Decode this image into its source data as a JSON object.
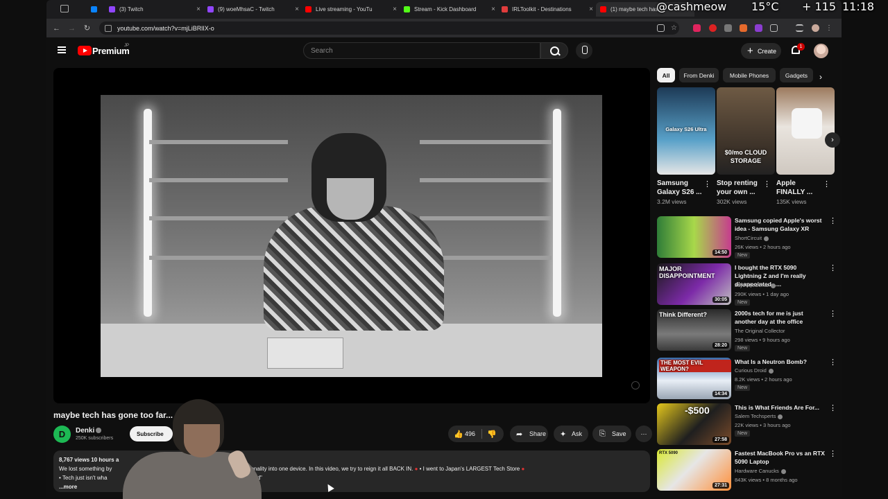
{
  "browser": {
    "tabs": [
      {
        "title": "(3) Twitch",
        "color": "#9146ff"
      },
      {
        "title": "(9) woeMhsaC - Twitch",
        "color": "#9146ff"
      },
      {
        "title": "Live streaming - YouTu",
        "color": "#ff0000"
      },
      {
        "title": "Stream - Kick Dashboard",
        "color": "#53fc18"
      },
      {
        "title": "IRLToolkit - Destinations",
        "color": "#e03c3c"
      },
      {
        "title": "(1) maybe tech has",
        "color": "#ff0000"
      }
    ],
    "url": "youtube.com/watch?v=mjLiBRlIX-o"
  },
  "hud": {
    "handle": "@cashmeow",
    "temp": "15°C",
    "speed": "+ 115",
    "time": "11:18"
  },
  "youtube": {
    "brand": "Premium",
    "region": "JP",
    "search_placeholder": "Search",
    "create_label": "Create",
    "notification_count": "1"
  },
  "video": {
    "title": "maybe tech has gone too far...",
    "channel": {
      "name": "Denki",
      "initial": "D",
      "subscribers": "250K subscribers"
    },
    "subscribe_label": "Subscribe",
    "likes": "496",
    "share_label": "Share",
    "ask_label": "Ask",
    "save_label": "Save",
    "description": {
      "stats": "8,767 views  10 hours a",
      "line1_start": "We lost something by",
      "line1_end": "LOT of functionality into one device. In this video, we try to reign it all BACK IN.",
      "line1_link": "• I went to Japan's LARGEST Tech Store",
      "line2_start": "• Tech just isn't wha",
      "line2_end": "iPod\"",
      "more": "...more"
    }
  },
  "sidebar": {
    "chips": [
      "All",
      "From Denki",
      "Mobile Phones",
      "Gadgets"
    ],
    "shorts": [
      {
        "title": "Samsung Galaxy S26 ...",
        "views": "3.2M views",
        "overlay": "Galaxy S26 Ultra"
      },
      {
        "title": "Stop renting your own ...",
        "views": "302K views",
        "overlay": "$0/mo CLOUD STORAGE"
      },
      {
        "title": "Apple FINALLY ...",
        "views": "135K views",
        "overlay": ""
      }
    ],
    "recommendations": [
      {
        "title": "Samsung copied Apple's worst idea - Samsung Galaxy XR",
        "channel": "ShortCircuit",
        "meta": "26K views • 2 hours ago",
        "badge": "New",
        "duration": "14:50",
        "thumb_text": ""
      },
      {
        "title": "I bought the RTX 5090 Lightning Z and I'm really disappointed......",
        "channel": "JayzTwoCents",
        "meta": "290K views • 1 day ago",
        "badge": "New",
        "duration": "30:05",
        "thumb_text": "MAJOR DISAPPOINTMENT"
      },
      {
        "title": "2000s tech for me is just another day at the office",
        "channel": "The Original Collector",
        "meta": "298 views • 9 hours ago",
        "badge": "New",
        "duration": "28:20",
        "thumb_text": "Think Different?"
      },
      {
        "title": "What Is a Neutron Bomb?",
        "channel": "Curious Droid",
        "meta": "8.2K views • 2 hours ago",
        "badge": "New",
        "duration": "14:34",
        "thumb_text": "THE MOST EVIL WEAPON?"
      },
      {
        "title": "This is What Friends Are For...",
        "channel": "Salem Techsperts",
        "meta": "22K views • 3 hours ago",
        "badge": "New",
        "duration": "27:58",
        "thumb_text": "-$500"
      },
      {
        "title": "Fastest MacBook Pro vs an RTX 5090 Laptop",
        "channel": "Hardware Canucks",
        "meta": "843K views • 8 months ago",
        "badge": "",
        "duration": "27:31",
        "thumb_text": "RTX 5090"
      }
    ]
  }
}
